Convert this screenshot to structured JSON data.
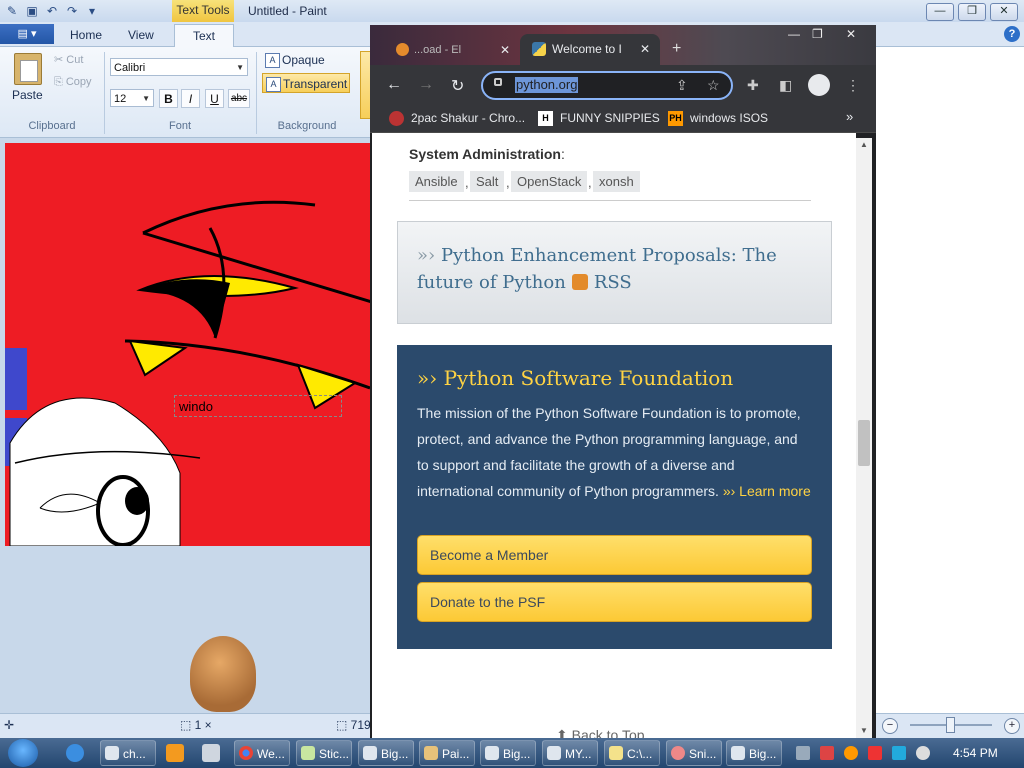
{
  "paint": {
    "title": "Untitled - Paint",
    "context_tab": "Text Tools",
    "tabs": [
      "Home",
      "View",
      "Text"
    ],
    "clipboard": {
      "paste": "Paste",
      "cut": "Cut",
      "copy": "Copy",
      "group": "Clipboard"
    },
    "font": {
      "family": "Calibri",
      "size": "12",
      "bold": "B",
      "italic": "I",
      "underline": "U",
      "strike": "abc",
      "group": "Font"
    },
    "background": {
      "opaque": "Opaque",
      "transparent": "Transparent",
      "group": "Background"
    },
    "text_box_value": "windo",
    "status": {
      "selection": "1 ×",
      "size": "719 ×"
    }
  },
  "chrome": {
    "tabs": [
      {
        "label": "...oad - El"
      },
      {
        "label": "Welcome to I"
      }
    ],
    "url": "python.org",
    "bookmarks": [
      {
        "label": "2pac Shakur - Chro...",
        "icon": "chrome-icon"
      },
      {
        "label": "FUNNY SNIPPIES",
        "icon": "H"
      },
      {
        "label": "windows ISOS",
        "icon": "PH"
      }
    ]
  },
  "page": {
    "sysadmin_label": "System Administration",
    "sysadmin_tags": [
      "Ansible",
      "Salt",
      "OpenStack",
      "xonsh"
    ],
    "pep_text": "Python Enhancement Proposals: The future of Python",
    "pep_rss": "RSS",
    "psf_title": "Python Software Foundation",
    "psf_text": "The mission of the Python Software Foundation is to promote, protect, and advance the Python programming language, and to support and facilitate the growth of a diverse and international community of Python programmers.",
    "learn_more": "Learn more",
    "become_member": "Become a Member",
    "donate": "Donate to the PSF",
    "back_to_top": "Back to Top"
  },
  "taskbar": {
    "items": [
      {
        "label": "ch..."
      },
      {
        "label": ""
      },
      {
        "label": ""
      },
      {
        "label": "We..."
      },
      {
        "label": "Stic..."
      },
      {
        "label": "Big..."
      },
      {
        "label": "Pai..."
      },
      {
        "label": "Big..."
      },
      {
        "label": "MY..."
      },
      {
        "label": "C:\\..."
      },
      {
        "label": "Sni..."
      },
      {
        "label": "Big..."
      }
    ],
    "clock": "4:54 PM"
  },
  "colors": {
    "canvas": "#ee1c24",
    "psf_bg": "#2b4a6c",
    "psf_accent": "#ffd343",
    "button_yellow": "#fcc935",
    "url_highlight": "#6d96d9"
  }
}
